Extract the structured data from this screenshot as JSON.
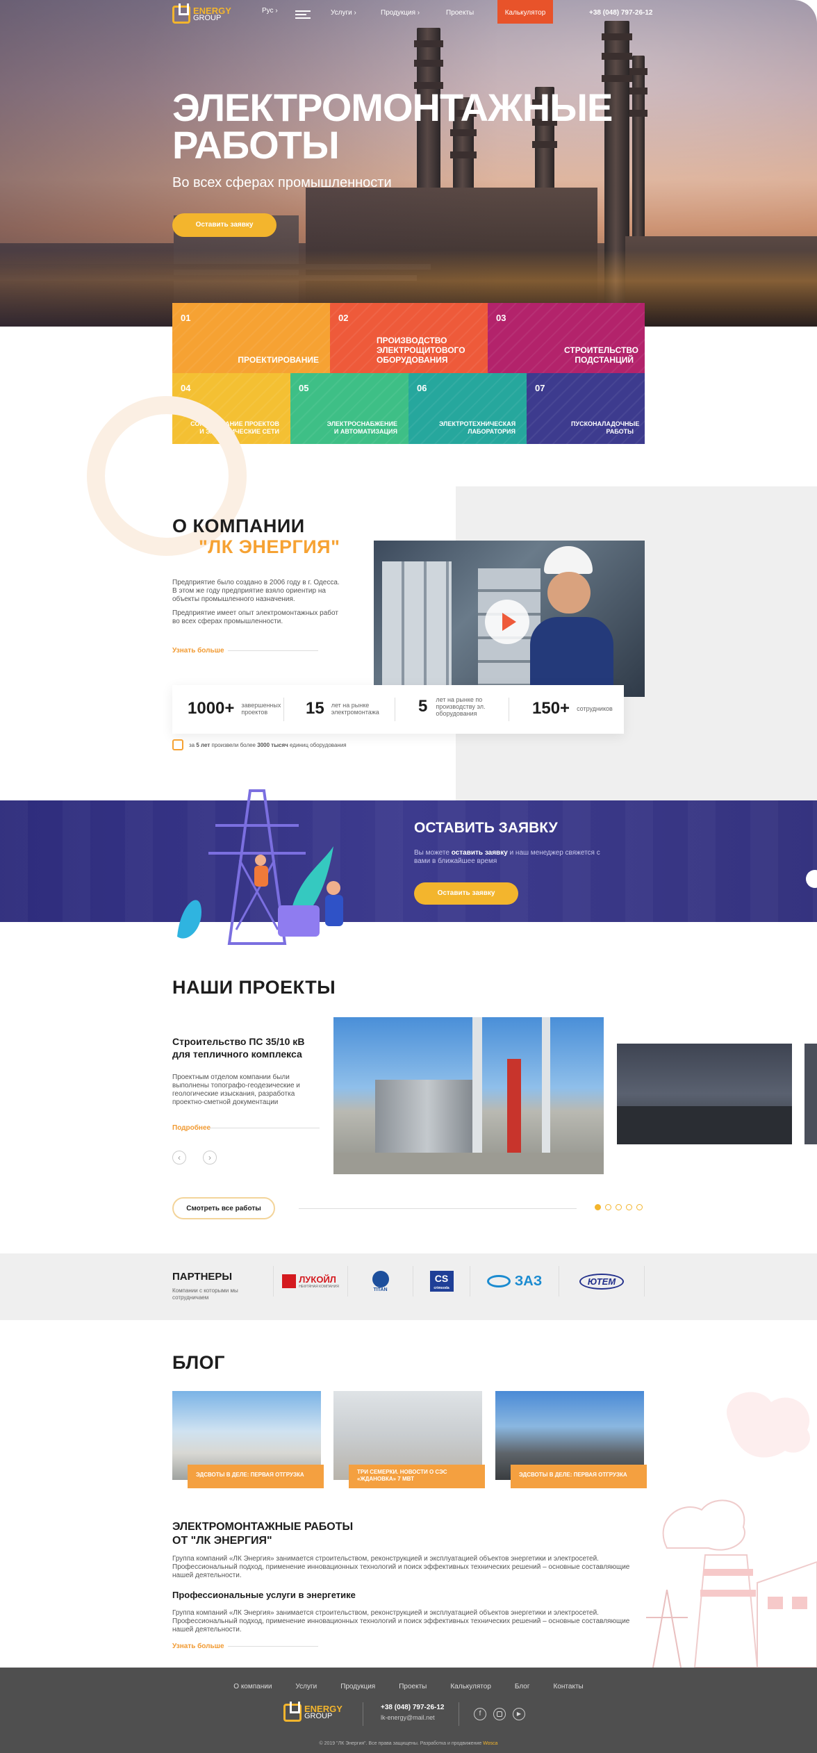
{
  "header": {
    "logo_top": "LK",
    "logo_energy": "ENERGY",
    "logo_group": "GROUP",
    "lang": "Рус",
    "menu": [
      "Услуги",
      "Продукция",
      "Проекты"
    ],
    "calc": "Калькулятор",
    "phone": "+38 (048) 797-26-12"
  },
  "hero": {
    "title_line1": "ЭЛЕКТРОМОНТАЖНЫЕ",
    "title_line2": "РАБОТЫ",
    "subtitle": "Во всех сферах промышленности",
    "cta": "Оставить заявку"
  },
  "services": [
    {
      "num": "01",
      "title": "ПРОЕКТИРОВАНИЕ"
    },
    {
      "num": "02",
      "title": "ПРОИЗВОДСТВО ЭЛЕКТРОЩИТОВОГО ОБОРУДОВАНИЯ"
    },
    {
      "num": "03",
      "title": "СТРОИТЕЛЬСТВО ПОДСТАНЦИЙ"
    },
    {
      "num": "04",
      "title": "СОГЛАСОВАНИЕ ПРОЕКТОВ И ЭЛЕКТРИЧЕСКИЕ СЕТИ"
    },
    {
      "num": "05",
      "title": "ЭЛЕКТРОСНАБЖЕНИЕ И АВТОМАТИЗАЦИЯ"
    },
    {
      "num": "06",
      "title": "ЭЛЕКТРОТЕХНИЧЕСКАЯ ЛАБОРАТОРИЯ"
    },
    {
      "num": "07",
      "title": "ПУСКОНАЛАДОЧНЫЕ РАБОТЫ"
    }
  ],
  "about": {
    "title": "О КОМПАНИИ",
    "title_accent": "\"ЛК ЭНЕРГИЯ\"",
    "p1": "Предприятие было создано в 2006 году в г. Одесса. В этом же году предприятие взяло ориентир на объекты промышленного назначения.",
    "p2": "Предприятие имеет опыт электромонтажных работ во всех сферах промышленности.",
    "more": "Узнать больше",
    "stats": [
      {
        "value": "1000+",
        "label": "завершенных проектов"
      },
      {
        "value": "15",
        "label": "лет на рынке электромонтажа"
      },
      {
        "value": "5",
        "label": "лет на рынке по производству эл. оборудования"
      },
      {
        "value": "150+",
        "label": "сотрудников"
      }
    ],
    "note_pre": "за",
    "note_years": "5 лет",
    "note_mid": "произвели более",
    "note_count": "3000 тысяч",
    "note_post": "единиц оборудования"
  },
  "request": {
    "title": "ОСТАВИТЬ ЗАЯВКУ",
    "text_pre": "Вы можете",
    "text_bold": "оставить заявку",
    "text_post": "и наш менеджер свяжется с вами в ближайшее время",
    "button": "Оставить заявку"
  },
  "projects": {
    "title": "НАШИ ПРОЕКТЫ",
    "item_title": "Строительство ПС 35/10 кВ для тепличного комплекса",
    "item_text": "Проектным отделом компании были выполнены топографо-геодезические и геологические изыскания, разработка проектно-сметной документации",
    "more": "Подробнее",
    "all": "Смотреть все работы"
  },
  "partners": {
    "title": "ПАРТНЕРЫ",
    "subtitle": "Компании с которыми мы сотрудничаем",
    "logos": [
      "ЛУКОЙЛ",
      "TITAN",
      "CS",
      "ЗАЗ",
      "ЮТЕМ"
    ],
    "lukoil_sub": "НЕФТЯНАЯ КОМПАНИЯ",
    "cs_sub": "crimsoda"
  },
  "blog": {
    "title": "БЛОГ",
    "posts": [
      "ЭДСВОТЫ В ДЕЛЕ: ПЕРВАЯ ОТГРУЗКА",
      "ТРИ СЕМЕРКИ. НОВОСТИ О СЭС «ЖДАНОВКА» 7 МВТ",
      "ЭДСВОТЫ В ДЕЛЕ: ПЕРВАЯ ОТГРУЗКА"
    ]
  },
  "seo": {
    "title_line1": "ЭЛЕКТРОМОНТАЖНЫЕ РАБОТЫ",
    "title_line2": "ОТ \"ЛК ЭНЕРГИЯ\"",
    "p1": "Группа компаний «ЛК Энергия» занимается строительством, реконструкцией и эксплуатацией объектов энергетики и электросетей. Профессиональный подход, применение инновационных технологий и поиск эффективных технических решений – основные составляющие нашей деятельности.",
    "subtitle": "Профессиональные услуги в энергетике",
    "p2": "Группа компаний «ЛК Энергия» занимается строительством, реконструкцией и эксплуатацией объектов энергетики и электросетей. Профессиональный подход, применение инновационных технологий и поиск эффективных технических решений – основные составляющие нашей деятельности.",
    "more": "Узнать больше"
  },
  "footer": {
    "menu": [
      "О компании",
      "Услуги",
      "Продукция",
      "Проекты",
      "Калькулятор",
      "Блог",
      "Контакты"
    ],
    "phone": "+38 (048) 797-26-12",
    "email": "lk-energy@mail.net",
    "copyright": "© 2019 \"ЛК Энергия\". Все права защищены. Разработка и продвижение",
    "dev": "Wosca"
  },
  "colors": {
    "orange": "#f6a233",
    "red": "#ee5a3a",
    "magenta": "#b3236b",
    "yellow": "#f4c033",
    "green": "#3ebf86",
    "teal": "#26a79d",
    "indigo": "#3d3b8e",
    "gold": "#f3b52d",
    "calc": "#e8532a"
  }
}
